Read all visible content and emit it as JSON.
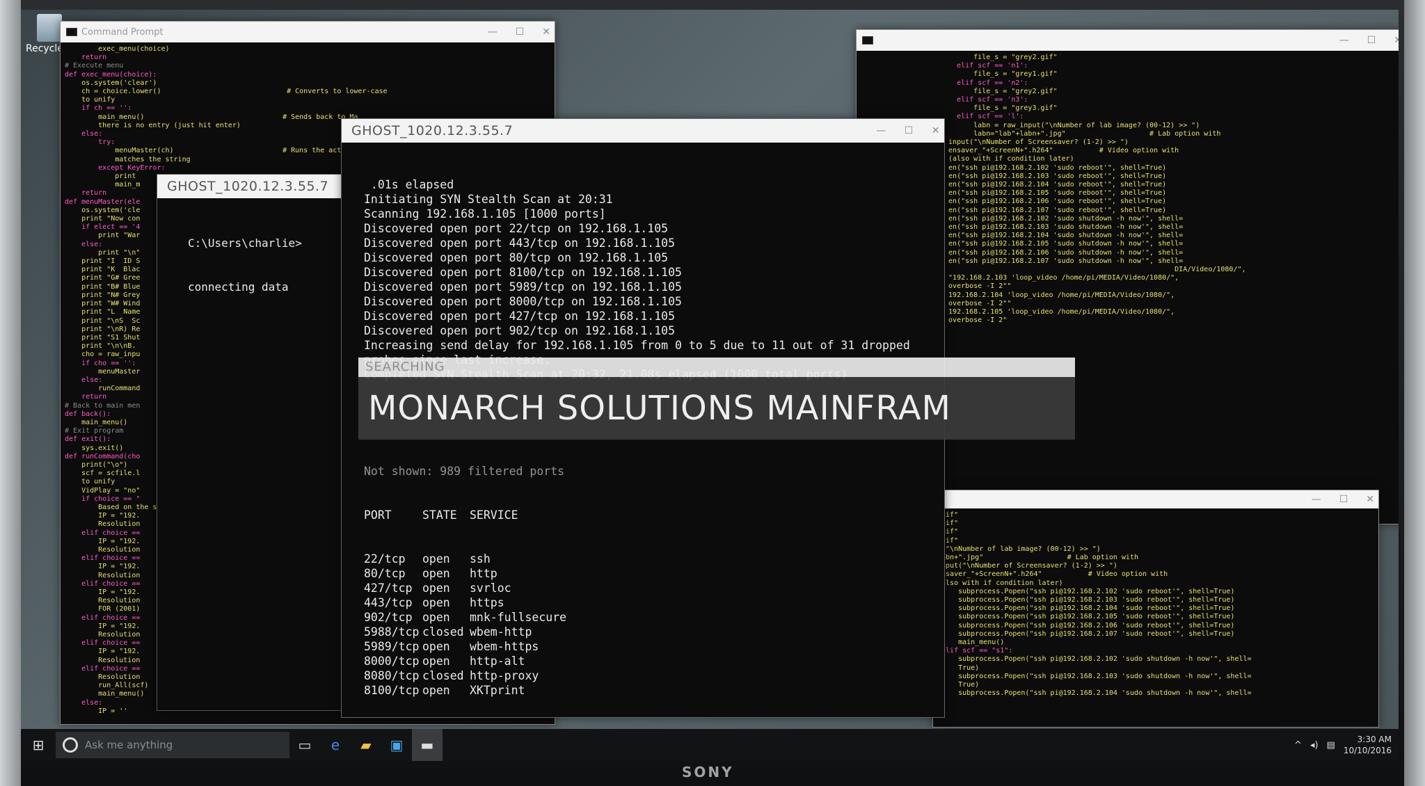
{
  "device": {
    "brand": "SONY"
  },
  "desktop": {
    "recycle_label": "Recycle B"
  },
  "left_window": {
    "title": "Command Prompt",
    "code_lines": [
      "        exec_menu(choice)",
      "    return",
      "",
      "# Execute menu",
      "def exec_menu(choice):",
      "    os.system('clear')",
      "    ch = choice.lower()                              # Converts to lower-case",
      "    to unify",
      "    if ch == '':",
      "        main_menu()                                 # Sends back to Ma",
      "        there is no entry (just hit enter)",
      "    else:",
      "        try:",
      "            menuMaster(ch)                          # Runs the action",
      "            matches the string",
      "        except KeyError:",
      "            print",
      "            main_m",
      "    return",
      "",
      "def menuMaster(ele",
      "    os.system('cle",
      "    print \"Now con",
      "    if elect == '4",
      "        print \"War",
      "    else:",
      "        print \"\\n\"",
      "    print \"I  ID S",
      "    print \"K  Blac",
      "    print \"G# Gree",
      "    print \"B# Blue",
      "    print \"N# Grey",
      "    print \"W# Wind",
      "    print \"L  Name",
      "    print \"\\nS  Sc",
      "    print \"\\nR) Re",
      "    print \"S1 Shut",
      "    print \"\\n\\nB. ",
      "    cho = raw_inpu",
      "    if cho == '':",
      "        menuMaster",
      "    else:",
      "        runCommand",
      "    return",
      "",
      "# Back to main men",
      "def back():",
      "    main_menu()",
      "",
      "# Exit program",
      "def exit():",
      "    sys.exit()",
      "",
      "def runCommand(cho",
      "    print(\"\\o\")",
      "",
      "    scf = scfile.l",
      "    to unify",
      "    VidPlay = \"no\"",
      "",
      "    if choice == \"",
      "        Based on the se",
      "        IP = \"192.",
      "        Resolution",
      "    elif choice ==",
      "        IP = \"192.",
      "        Resolution",
      "    elif choice ==",
      "        IP = \"192.",
      "        Resolution",
      "    elif choice ==",
      "        IP = \"192.",
      "        Resolution",
      "        FOR (2001)",
      "    elif choice ==",
      "        IP = \"192.",
      "        Resolution",
      "    elif choice ==",
      "        IP = \"192.",
      "        Resolution",
      "    elif choice ==",
      "        Resolution",
      "        run_All(scf)",
      "        main_menu()",
      "    else:",
      "        IP = ''"
    ]
  },
  "small_ghost": {
    "title": "GHOST_1020.12.3.55.7",
    "lines": [
      "C:\\Users\\charlie>",
      "connecting data"
    ]
  },
  "main_ghost": {
    "title": "GHOST_1020.12.3.55.7",
    "lines": [
      " .01s elapsed",
      "Initiating SYN Stealth Scan at 20:31",
      "Scanning 192.168.1.105 [1000 ports]",
      "Discovered open port 22/tcp on 192.168.1.105",
      "Discovered open port 443/tcp on 192.168.1.105",
      "Discovered open port 80/tcp on 192.168.1.105",
      "Discovered open port 8100/tcp on 192.168.1.105",
      "Discovered open port 5989/tcp on 192.168.1.105",
      "Discovered open port 8000/tcp on 192.168.1.105",
      "Discovered open port 427/tcp on 192.168.1.105",
      "Discovered open port 902/tcp on 192.168.1.105",
      "Increasing send delay for 192.168.1.105 from 0 to 5 due to 11 out of 31 dropped",
      "probes since last increase.",
      "Completed SYN Stealth Scan at 20:32, 21.08s elapsed (1000 total ports)"
    ],
    "not_shown": "Not shown: 989 filtered ports",
    "port_header": {
      "port": "PORT",
      "state": "STATE",
      "service": "SERVICE"
    },
    "ports": [
      {
        "port": "22/tcp",
        "state": "open",
        "service": "ssh"
      },
      {
        "port": "80/tcp",
        "state": "open",
        "service": "http"
      },
      {
        "port": "427/tcp",
        "state": "open",
        "service": "svrloc"
      },
      {
        "port": "443/tcp",
        "state": "open",
        "service": "https"
      },
      {
        "port": "902/tcp",
        "state": "open",
        "service": "mnk-fullsecure"
      },
      {
        "port": "5988/tcp",
        "state": "closed",
        "service": "wbem-http"
      },
      {
        "port": "5989/tcp",
        "state": "open",
        "service": "wbem-https"
      },
      {
        "port": "8000/tcp",
        "state": "open",
        "service": "http-alt"
      },
      {
        "port": "8080/tcp",
        "state": "closed",
        "service": "http-proxy"
      },
      {
        "port": "8100/tcp",
        "state": "open",
        "service": "XKTprint"
      }
    ]
  },
  "search_banner": {
    "top": "SEARCHING",
    "main": "MONARCH SOLUTIONS MAINFRAM"
  },
  "right_window": {
    "title": "",
    "code_lines": [
      "        file_s = \"grey2.gif\"",
      "    elif scf == 'n1':",
      "        file_s = \"grey1.gif\"",
      "    elif scf == 'n2':",
      "        file_s = \"grey2.gif\"",
      "    elif scf == 'n3':",
      "        file_s = \"grey3.gif\"",
      "    elif scf == 'l':",
      "        labn = raw_input(\"\\nNumber of lab image? (00-12) >> \")",
      "        labn=\"lab\"+labn+\".jpg\"                    # Lab option with",
      "",
      "",
      "",
      "  input(\"\\nNumber of Screensaver? (1-2) >> \")",
      "  ensaver_\"+ScreenN+\".h264\"           # Video option with",
      "  (also with if condition later)",
      "",
      "  en(\"ssh pi@192.168.2.102 'sudo reboot'\", shell=True)",
      "  en(\"ssh pi@192.168.2.103 'sudo reboot'\", shell=True)",
      "  en(\"ssh pi@192.168.2.104 'sudo reboot'\", shell=True)",
      "  en(\"ssh pi@192.168.2.105 'sudo reboot'\", shell=True)",
      "  en(\"ssh pi@192.168.2.106 'sudo reboot'\", shell=True)",
      "  en(\"ssh pi@192.168.2.107 'sudo reboot'\", shell=True)",
      "",
      "  en(\"ssh pi@192.168.2.102 'sudo shutdown -h now'\", shell=",
      "",
      "  en(\"ssh pi@192.168.2.103 'sudo shutdown -h now'\", shell=",
      "",
      "  en(\"ssh pi@192.168.2.104 'sudo shutdown -h now'\", shell=",
      "",
      "  en(\"ssh pi@192.168.2.105 'sudo shutdown -h now'\", shell=",
      "",
      "  en(\"ssh pi@192.168.2.106 'sudo shutdown -h now'\", shell=",
      "",
      "  en(\"ssh pi@192.168.2.107 'sudo shutdown -h now'\", shell=",
      "",
      "",
      "",
      "",
      "",
      "                                                        DIA/Video/1080/\",",
      "  \"192.168.2.103 'loop_video /home/pi/MEDIA/Video/1080/\",",
      "  overbose -I 2\"\"",
      "  192.168.2.104 'loop_video /home/pi/MEDIA/Video/1080/\",",
      "  overbose -I 2\"\"",
      "  192.168.2.105 'loop_video /home/pi/MEDIA/Video/1080/\",",
      "  overbose -I 2\""
    ]
  },
  "lower_right_window": {
    "code_lines": [
      "",
      "-gif\"",
      "-gif\"",
      "-gif\"",
      "-gif\"",
      "",
      "t(\"\\nNumber of lab image? (00-12) >> \")",
      "labn+\".jpg\"                    # Lab option with",
      "",
      "input(\"\\nNumber of Screensaver? (1-2) >> \")",
      "ensaver_\"+ScreenN+\".h264\"           # Video option with",
      "(also with if condition later)",
      "",
      "",
      "",
      "     subprocess.Popen(\"ssh pi@192.168.2.102 'sudo reboot'\", shell=True)",
      "     subprocess.Popen(\"ssh pi@192.168.2.103 'sudo reboot'\", shell=True)",
      "     subprocess.Popen(\"ssh pi@192.168.2.104 'sudo reboot'\", shell=True)",
      "     subprocess.Popen(\"ssh pi@192.168.2.105 'sudo reboot'\", shell=True)",
      "     subprocess.Popen(\"ssh pi@192.168.2.106 'sudo reboot'\", shell=True)",
      "     subprocess.Popen(\"ssh pi@192.168.2.107 'sudo reboot'\", shell=True)",
      "     main_menu()",
      " elif scf == \"s1\":",
      "     subprocess.Popen(\"ssh pi@192.168.2.102 'sudo shutdown -h now'\", shell=",
      "     True)",
      "     subprocess.Popen(\"ssh pi@192.168.2.103 'sudo shutdown -h now'\", shell=",
      "     True)",
      "     subprocess.Popen(\"ssh pi@192.168.2.104 'sudo shutdown -h now'\", shell="
    ]
  },
  "taskbar": {
    "search_placeholder": "Ask me anything",
    "time": "3:30 AM",
    "date": "10/10/2016"
  }
}
